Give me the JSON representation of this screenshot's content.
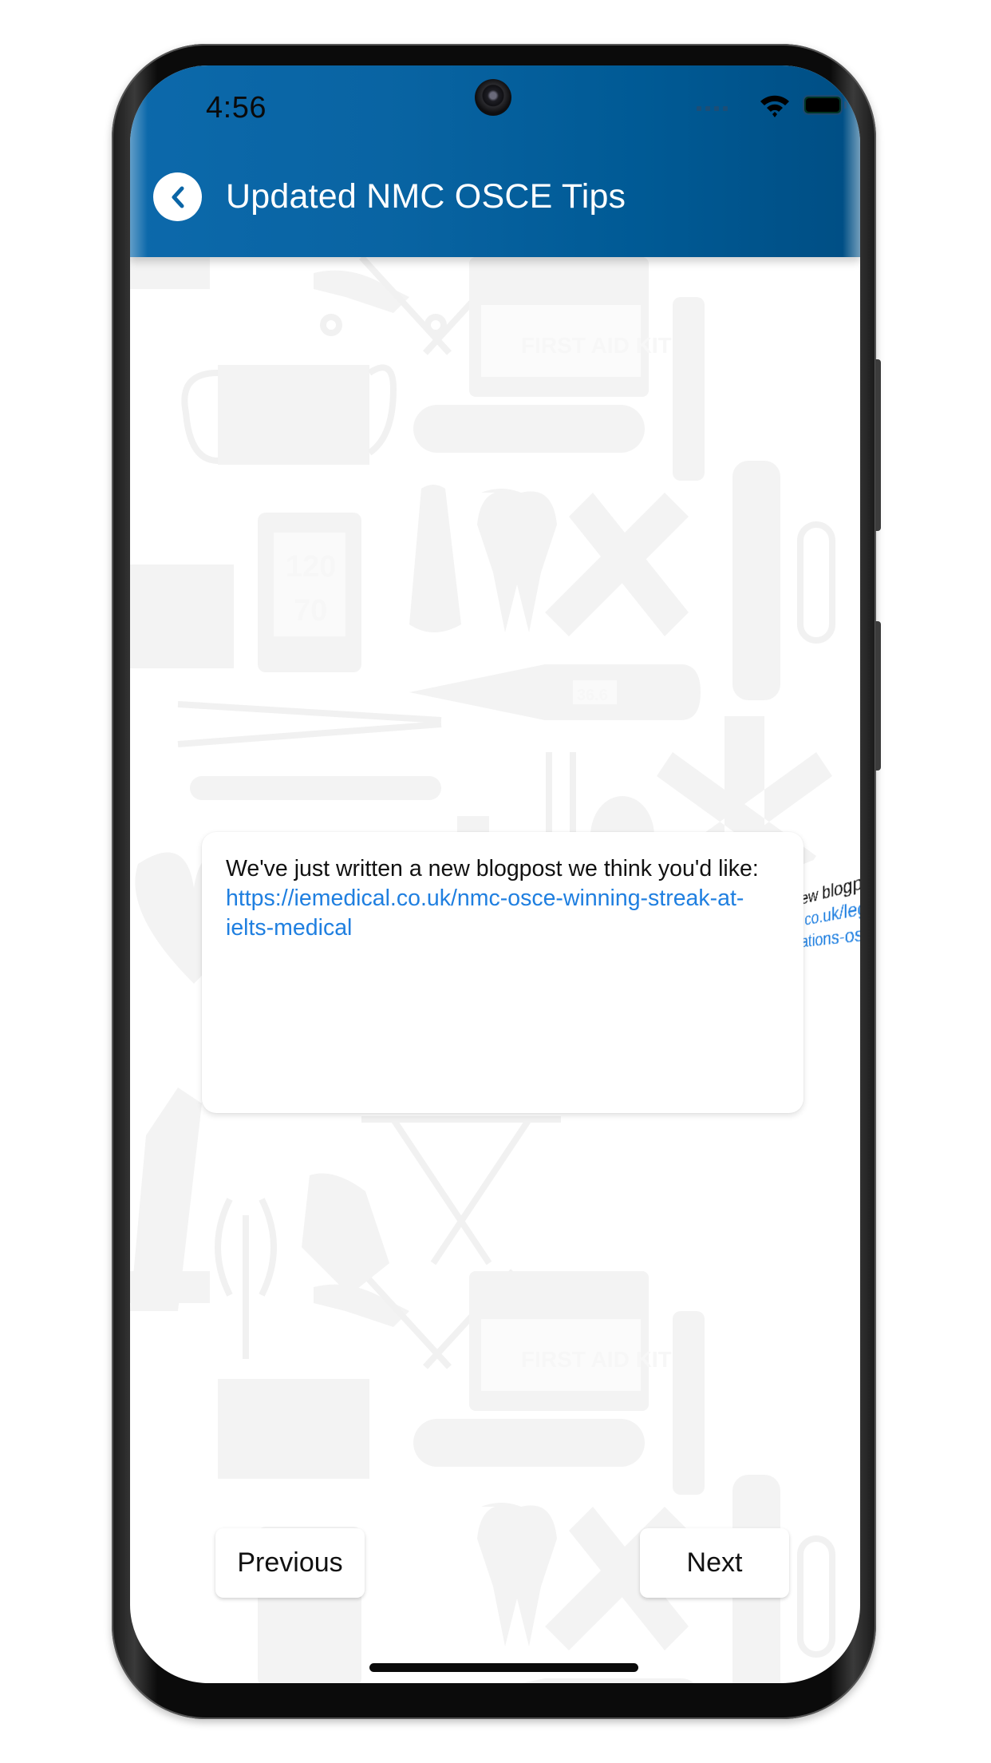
{
  "status_bar": {
    "time": "4:56",
    "icons": [
      "cellular-signal-icon",
      "wifi-icon",
      "battery-icon"
    ]
  },
  "header": {
    "back_icon": "chevron-left-icon",
    "title": "Updated NMC OSCE Tips",
    "colors": {
      "header_left": "#0c69ab",
      "header_right": "#004e84"
    }
  },
  "card": {
    "text_prefix": "We've just written a new blogpost we think you'd like: ",
    "link": "https://iemedical.co.uk/nmc-osce-winning-streak-at-ielts-medical",
    "link_color": "#1f7fe0"
  },
  "next_card_peek": {
    "line1": "ew blogpost",
    "line2": ".co.uk/legacy",
    "line3": "ations-osce"
  },
  "background": {
    "pattern_icons": [
      "first-aid-kit",
      "face-mask",
      "thermometer",
      "blood-pressure-monitor",
      "tooth",
      "bandage",
      "pill-capsule",
      "digital-thermometer",
      "tweezers",
      "syringe",
      "flask",
      "pill",
      "star-of-life",
      "clipboard",
      "heart",
      "scissors",
      "gloves",
      "stretcher",
      "microscope"
    ],
    "first_aid_label": "FIRST AID KIT",
    "bp_readings": [
      "120",
      "70"
    ],
    "thermo_reading": "36.6"
  },
  "footer": {
    "previous_label": "Previous",
    "next_label": "Next"
  }
}
